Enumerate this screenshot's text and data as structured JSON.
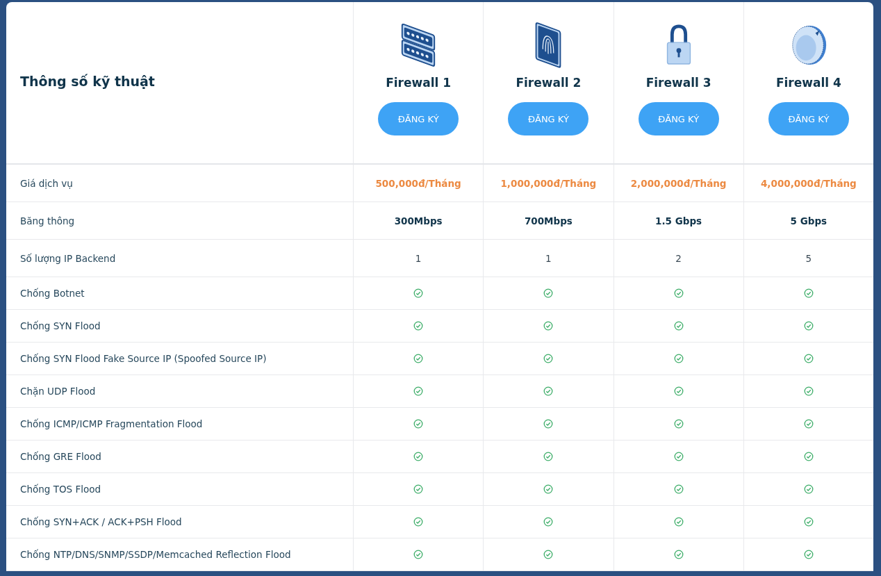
{
  "title": "Thông số kỹ thuật",
  "plans": [
    {
      "name": "Firewall 1",
      "kind": "server",
      "button": "ĐĂNG KÝ"
    },
    {
      "name": "Firewall 2",
      "kind": "fingerprint",
      "button": "ĐĂNG KÝ"
    },
    {
      "name": "Firewall 3",
      "kind": "padlock",
      "button": "ĐĂNG KÝ"
    },
    {
      "name": "Firewall 4",
      "kind": "dial",
      "button": "ĐĂNG KÝ"
    }
  ],
  "rows": [
    {
      "label": "Giá dịch vụ",
      "kind": "price",
      "values": [
        "500,000đ/Tháng",
        "1,000,000đ/Tháng",
        "2,000,000đ/Tháng",
        "4,000,000đ/Tháng"
      ]
    },
    {
      "label": "Băng thông",
      "kind": "bold",
      "values": [
        "300Mbps",
        "700Mbps",
        "1.5 Gbps",
        "5 Gbps"
      ]
    },
    {
      "label": "Số lượng IP Backend",
      "kind": "plain",
      "values": [
        "1",
        "1",
        "2",
        "5"
      ]
    },
    {
      "label": "Chống Botnet",
      "kind": "check",
      "checks": [
        true,
        true,
        true,
        true
      ]
    },
    {
      "label": "Chống SYN Flood",
      "kind": "check",
      "checks": [
        true,
        true,
        true,
        true
      ]
    },
    {
      "label": "Chống SYN Flood Fake Source IP (Spoofed Source IP)",
      "kind": "check",
      "checks": [
        true,
        true,
        true,
        true
      ]
    },
    {
      "label": "Chặn UDP Flood",
      "kind": "check",
      "checks": [
        true,
        true,
        true,
        true
      ]
    },
    {
      "label": "Chống ICMP/ICMP Fragmentation Flood",
      "kind": "check",
      "checks": [
        true,
        true,
        true,
        true
      ]
    },
    {
      "label": "Chống GRE Flood",
      "kind": "check",
      "checks": [
        true,
        true,
        true,
        true
      ]
    },
    {
      "label": "Chống TOS Flood",
      "kind": "check",
      "checks": [
        true,
        true,
        true,
        true
      ]
    },
    {
      "label": "Chống SYN+ACK / ACK+PSH Flood",
      "kind": "check",
      "checks": [
        true,
        true,
        true,
        true
      ]
    },
    {
      "label": "Chống NTP/DNS/SNMP/SSDP/Memcached Reflection Flood",
      "kind": "check",
      "checks": [
        true,
        true,
        true,
        true
      ]
    }
  ]
}
